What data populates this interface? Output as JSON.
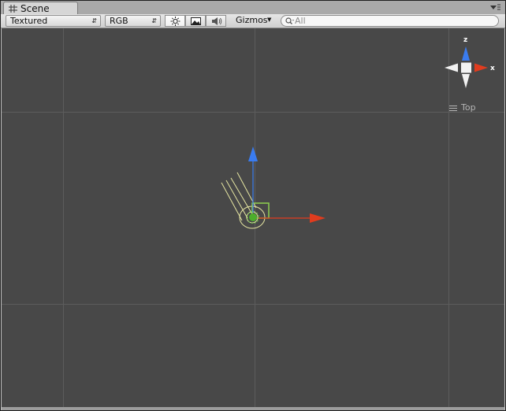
{
  "tab": {
    "label": "Scene",
    "icon": "grid-icon"
  },
  "toolbar": {
    "render_mode": "Textured",
    "color_mode": "RGB",
    "gizmos_label": "Gizmos",
    "search_placeholder": "All",
    "buttons": [
      "sun-icon",
      "image-icon",
      "speaker-icon"
    ]
  },
  "orientation_gizmo": {
    "axis_z": "z",
    "axis_x": "x",
    "view_label": "Top"
  },
  "colors": {
    "viewport_bg": "#484848",
    "grid": "#5c5c5c",
    "axis_x": "#e03c1e",
    "axis_z": "#3a7cf0",
    "light_gizmo": "#e8e8a0",
    "object": "#8fd14f"
  }
}
